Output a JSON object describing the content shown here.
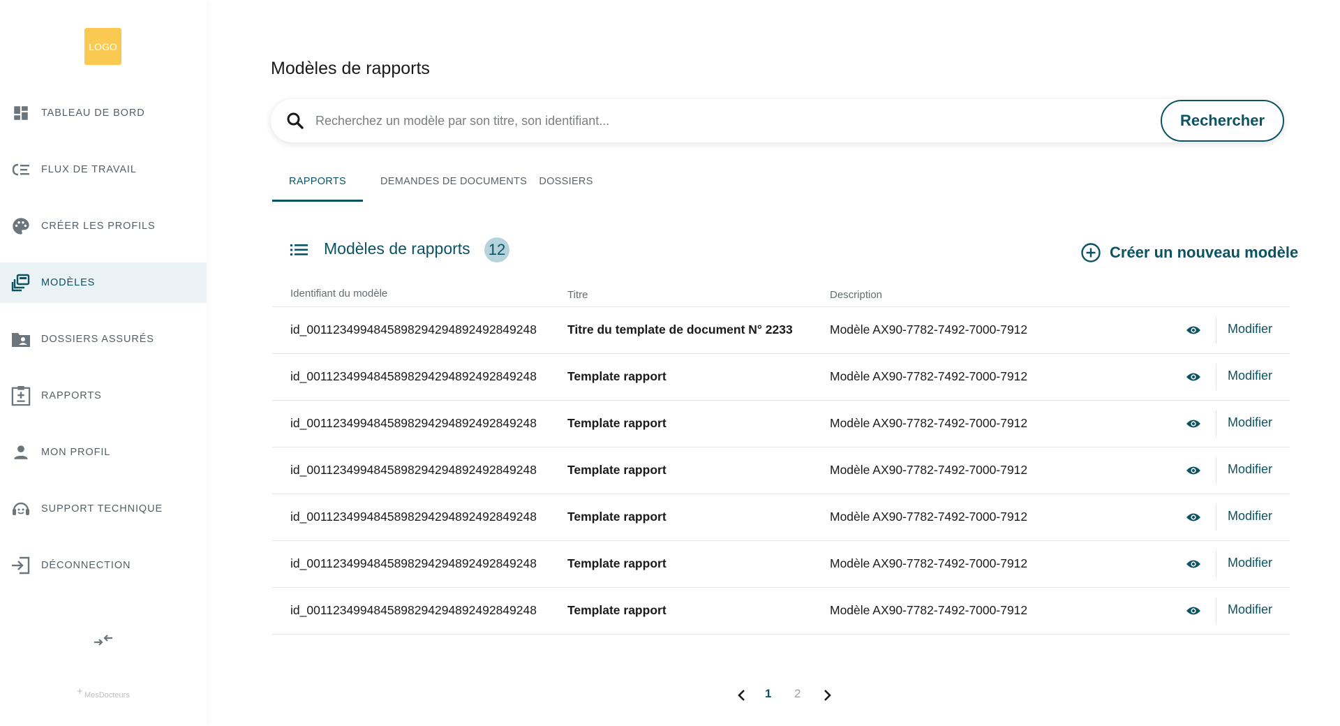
{
  "sidebar": {
    "logo": "LOGO",
    "items": [
      {
        "label": "TABLEAU DE BORD",
        "icon": "dashboard-icon",
        "active": false
      },
      {
        "label": "FLUX DE TRAVAIL",
        "icon": "workflow-icon",
        "active": false
      },
      {
        "label": "CRÉER LES PROFILS",
        "icon": "palette-icon",
        "active": false
      },
      {
        "label": "MODÈLES",
        "icon": "templates-icon",
        "active": true
      },
      {
        "label": "DOSSIERS ASSURÉS",
        "icon": "folder-user-icon",
        "active": false
      },
      {
        "label": "RAPPORTS",
        "icon": "report-icon",
        "active": false
      },
      {
        "label": "MON PROFIL",
        "icon": "person-icon",
        "active": false
      },
      {
        "label": "SUPPORT TECHNIQUE",
        "icon": "support-icon",
        "active": false
      },
      {
        "label": "DÉCONNECTION",
        "icon": "logout-icon",
        "active": false
      }
    ],
    "brand": "MesDocteurs",
    "brand_plus": "+"
  },
  "main": {
    "title": "Modèles de rapports",
    "search": {
      "placeholder": "Recherchez un modèle par son titre, son identifiant...",
      "button_label": "Rechercher"
    },
    "tabs": [
      {
        "label": "RAPPORTS",
        "active": true
      },
      {
        "label": "DEMANDES DE DOCUMENTS",
        "active": false
      },
      {
        "label": "DOSSIERS",
        "active": false
      }
    ],
    "section": {
      "title": "Modèles de rapports",
      "count": "12",
      "create_label": "Créer un nouveau modèle"
    },
    "table": {
      "headers": {
        "id": "Identifiant du modèle",
        "title": "Titre",
        "description": "Description"
      },
      "action_label": "Modifier",
      "rows": [
        {
          "id": "id_001123499484589829429489249284924​8",
          "title": "Titre du template de document N° 2233",
          "description": "Modèle AX90-7782-7492-7000-7912"
        },
        {
          "id": "id_0011234994845898294294892492849248",
          "title": "Template rapport",
          "description": "Modèle AX90-7782-7492-7000-7912"
        },
        {
          "id": "id_0011234994845898294294892492849248",
          "title": "Template rapport",
          "description": "Modèle AX90-7782-7492-7000-7912"
        },
        {
          "id": "id_0011234994845898294294892492849248",
          "title": "Template rapport",
          "description": "Modèle AX90-7782-7492-7000-7912"
        },
        {
          "id": "id_0011234994845898294294892492849248",
          "title": "Template rapport",
          "description": "Modèle AX90-7782-7492-7000-7912"
        },
        {
          "id": "id_0011234994845898294294892492849248",
          "title": "Template rapport",
          "description": "Modèle AX90-7782-7492-7000-7912"
        },
        {
          "id": "id_0011234994845898294294892492849248",
          "title": "Template rapport",
          "description": "Modèle AX90-7782-7492-7000-7912"
        }
      ]
    },
    "pagination": {
      "pages": [
        "1",
        "2"
      ],
      "current": "1"
    }
  },
  "colors": {
    "accent": "#0b5263",
    "active_bg": "#eaf2f5",
    "badge_bg": "#b6d3dc",
    "logo_bg": "#f9c440"
  }
}
